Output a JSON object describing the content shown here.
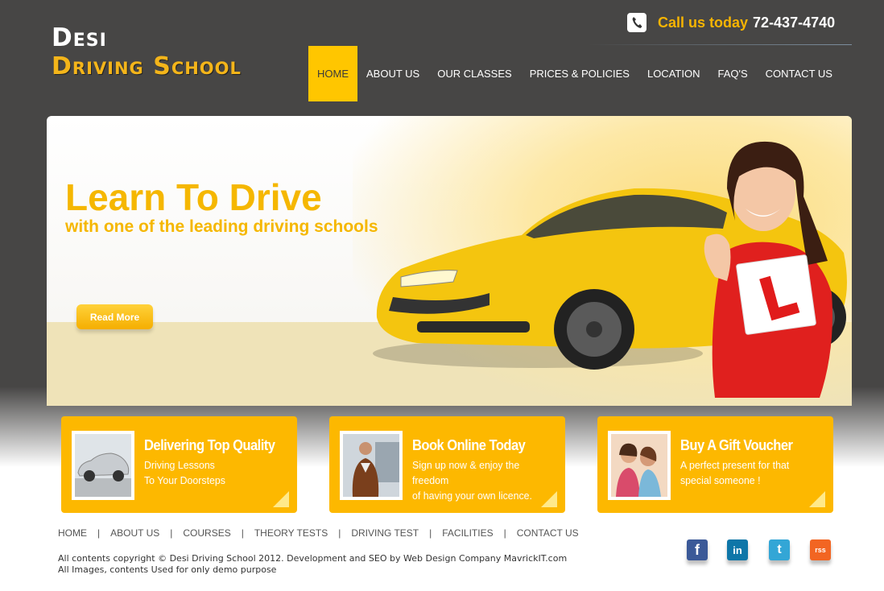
{
  "brand": {
    "line1": "Desi",
    "line2": "Driving School"
  },
  "contact": {
    "label": "Call us today",
    "phone": "72-437-4740"
  },
  "nav": [
    {
      "label": "HOME"
    },
    {
      "label": "ABOUT US"
    },
    {
      "label": "OUR CLASSES"
    },
    {
      "label": "PRICES & POLICIES"
    },
    {
      "label": "LOCATION"
    },
    {
      "label": "FAQ'S"
    },
    {
      "label": "CONTACT US"
    }
  ],
  "hero": {
    "title": "Learn To Drive",
    "subtitle": "with one of the leading driving schools",
    "button": "Read More"
  },
  "features": [
    {
      "title": "Delivering Top Quality",
      "text": "Driving Lessons\nTo Your Doorsteps"
    },
    {
      "title": "Book Online Today",
      "text": "Sign up now & enjoy the freedom\nof having your own licence."
    },
    {
      "title": "Buy A Gift Voucher",
      "text": "A perfect present for that\nspecial someone !"
    }
  ],
  "footer": {
    "links": [
      {
        "label": "HOME"
      },
      {
        "label": "ABOUT US"
      },
      {
        "label": "COURSES"
      },
      {
        "label": "THEORY TESTS"
      },
      {
        "label": "DRIVING TEST"
      },
      {
        "label": "FACILITIES"
      },
      {
        "label": "CONTACT US"
      }
    ],
    "copyright": "All contents copyright © Desi Driving School 2012. Development and SEO by Web Design Company MavrickIT.com",
    "disclaimer": "All Images, contents Used for only demo purpose"
  },
  "social": [
    {
      "icon": "facebook-icon",
      "glyph": "f",
      "color": "#3b5998"
    },
    {
      "icon": "linkedin-icon",
      "glyph": "in",
      "color": "#0e76a8"
    },
    {
      "icon": "twitter-icon",
      "glyph": "t",
      "color": "#33a6d6"
    },
    {
      "icon": "rss-icon",
      "glyph": "rss",
      "color": "#f26522"
    }
  ],
  "colors": {
    "accent": "#ffc600",
    "box": "#fdb800",
    "header_bg": "#474645"
  }
}
